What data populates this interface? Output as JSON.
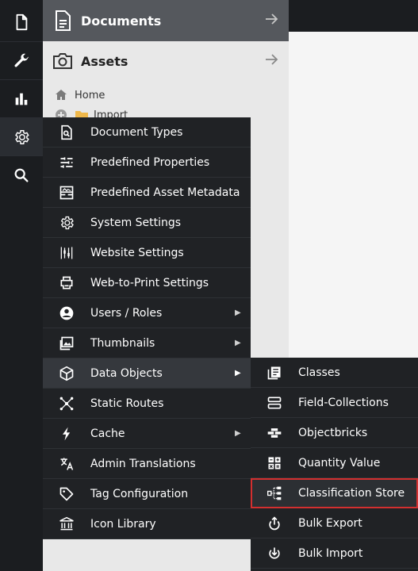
{
  "rail": {
    "items": [
      {
        "icon": "document-icon"
      },
      {
        "icon": "wrench-icon"
      },
      {
        "icon": "bar-chart-icon"
      },
      {
        "icon": "gear-icon"
      },
      {
        "icon": "search-icon"
      }
    ]
  },
  "tree_panels": {
    "documents_title": "Documents",
    "assets_title": "Assets",
    "tree_items": [
      "Home",
      "Import"
    ]
  },
  "menu": {
    "items": [
      {
        "label": "Document Types",
        "icon": "document-search-icon",
        "has_submenu": false
      },
      {
        "label": "Predefined Properties",
        "icon": "sliders-icon",
        "has_submenu": false
      },
      {
        "label": "Predefined Asset Metadata",
        "icon": "image-details-icon",
        "has_submenu": false
      },
      {
        "label": "System Settings",
        "icon": "gear-icon",
        "has_submenu": false
      },
      {
        "label": "Website Settings",
        "icon": "website-settings-icon",
        "has_submenu": false
      },
      {
        "label": "Web-to-Print Settings",
        "icon": "printer-icon",
        "has_submenu": false
      },
      {
        "label": "Users / Roles",
        "icon": "user-circle-icon",
        "has_submenu": true
      },
      {
        "label": "Thumbnails",
        "icon": "photo-icon",
        "has_submenu": true
      },
      {
        "label": "Data Objects",
        "icon": "cube-icon",
        "has_submenu": true,
        "active": true
      },
      {
        "label": "Static Routes",
        "icon": "network-icon",
        "has_submenu": false
      },
      {
        "label": "Cache",
        "icon": "lightning-icon",
        "has_submenu": true
      },
      {
        "label": "Admin Translations",
        "icon": "translate-icon",
        "has_submenu": false
      },
      {
        "label": "Tag Configuration",
        "icon": "tag-icon",
        "has_submenu": false
      },
      {
        "label": "Icon Library",
        "icon": "bank-icon",
        "has_submenu": false
      }
    ]
  },
  "submenu": {
    "items": [
      {
        "label": "Classes",
        "icon": "classes-icon"
      },
      {
        "label": "Field-Collections",
        "icon": "field-collections-icon"
      },
      {
        "label": "Objectbricks",
        "icon": "bricks-icon"
      },
      {
        "label": "Quantity Value",
        "icon": "calculator-icon"
      },
      {
        "label": "Classification Store",
        "icon": "tree-structure-icon",
        "highlighted": true
      },
      {
        "label": "Bulk Export",
        "icon": "export-icon"
      },
      {
        "label": "Bulk Import",
        "icon": "import-icon"
      }
    ]
  },
  "colors": {
    "highlight_border": "#d32f2f",
    "menu_bg": "#202225",
    "active_item_bg": "#35383d"
  }
}
